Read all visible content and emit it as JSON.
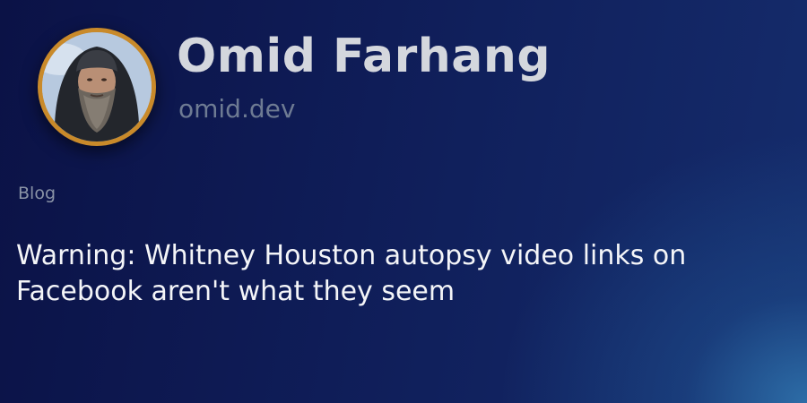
{
  "profile": {
    "name": "Omid Farhang",
    "domain": "omid.dev",
    "avatar_alt": "avatar"
  },
  "section_label": "Blog",
  "post": {
    "title": "Warning: Whitney Houston autopsy video links on Facebook aren't what they seem"
  },
  "colors": {
    "background_start": "#0b1246",
    "background_end": "#152c6c",
    "glow": "#2e70aa",
    "avatar_ring": "#c98a2a",
    "name_text": "#d4d7dd",
    "domain_text": "#6e7b93",
    "section_text": "#8a93a6",
    "title_text": "#f4f5f8"
  }
}
